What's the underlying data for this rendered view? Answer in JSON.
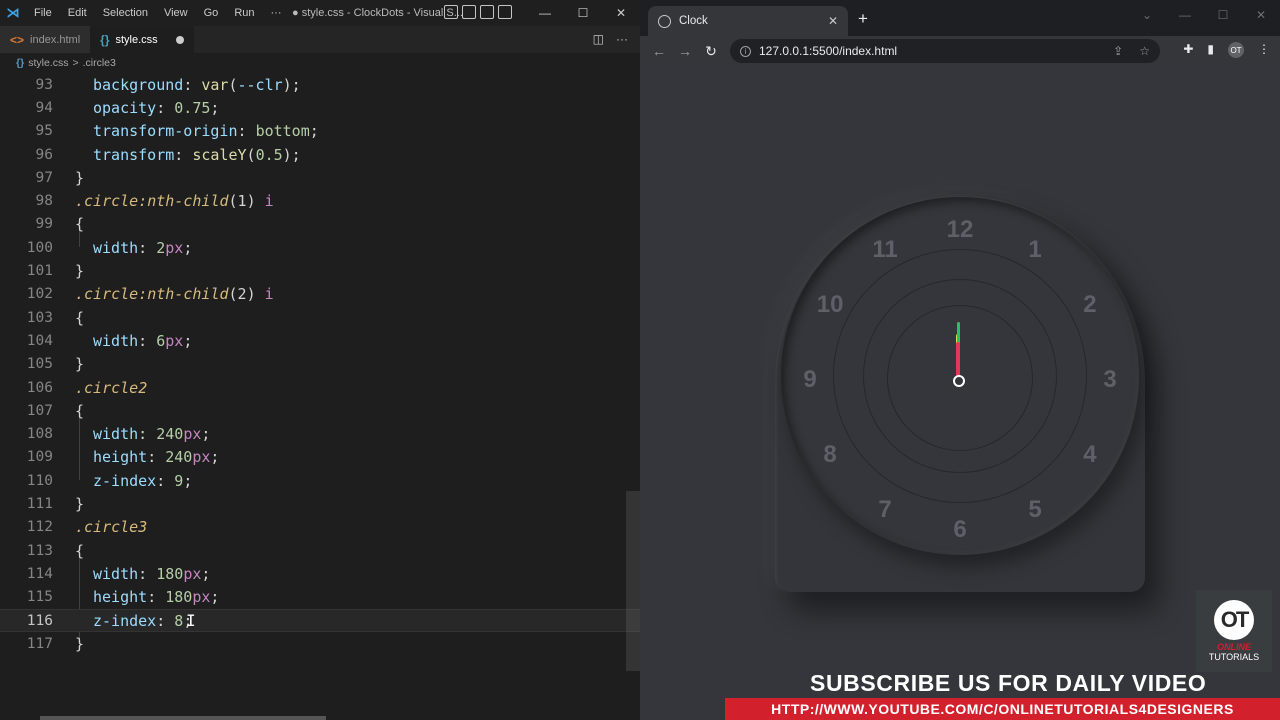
{
  "vscode": {
    "menu": [
      "File",
      "Edit",
      "Selection",
      "View",
      "Go",
      "Run",
      "···"
    ],
    "title": "● style.css - ClockDots - Visual S...",
    "tabs": [
      {
        "label": "index.html",
        "active": false
      },
      {
        "label": "style.css",
        "active": true,
        "dirty": true
      }
    ],
    "breadcrumb": {
      "file": "style.css",
      "sep": ">",
      "symbol": ".circle3"
    },
    "line_numbers": [
      "93",
      "94",
      "95",
      "96",
      "97",
      "98",
      "99",
      "100",
      "101",
      "102",
      "103",
      "104",
      "105",
      "106",
      "107",
      "108",
      "109",
      "110",
      "111",
      "112",
      "113",
      "114",
      "115",
      "116",
      "117"
    ],
    "current_line": "116",
    "code": {
      "l93": {
        "prop": "background",
        "fn": "var",
        "arg": "--clr"
      },
      "l94": {
        "prop": "opacity",
        "val": "0.75"
      },
      "l95": {
        "prop": "transform-origin",
        "val": "bottom"
      },
      "l96": {
        "prop": "transform",
        "fn": "scaleY",
        "arg": "0.5"
      },
      "l98": {
        "sel": ".circle",
        "pseudo": ":nth-child",
        "arg": "(1)",
        "child": "i"
      },
      "l100": {
        "prop": "width",
        "num": "2",
        "unit": "px"
      },
      "l102": {
        "sel": ".circle",
        "pseudo": ":nth-child",
        "arg": "(2)",
        "child": "i"
      },
      "l104": {
        "prop": "width",
        "num": "6",
        "unit": "px"
      },
      "l106": {
        "sel": ".circle2"
      },
      "l108": {
        "prop": "width",
        "num": "240",
        "unit": "px"
      },
      "l109": {
        "prop": "height",
        "num": "240",
        "unit": "px"
      },
      "l110": {
        "prop": "z-index",
        "num": "9"
      },
      "l112": {
        "sel": ".circle3"
      },
      "l114": {
        "prop": "width",
        "num": "180",
        "unit": "px"
      },
      "l115": {
        "prop": "height",
        "num": "180",
        "unit": "px"
      },
      "l116": {
        "prop": "z-index",
        "num": "8"
      }
    }
  },
  "browser": {
    "tab_title": "Clock",
    "url": "127.0.0.1:5500/index.html",
    "profile": "OT",
    "clock": {
      "numbers": [
        "12",
        "1",
        "2",
        "3",
        "4",
        "5",
        "6",
        "7",
        "8",
        "9",
        "10",
        "11"
      ],
      "hour_color": "#d4d94a",
      "minute_color": "#2ac06a",
      "second_color": "#e0385a"
    },
    "watermark": {
      "logo": "OT",
      "line1": "ONLINE",
      "line2": "TUTORIALS"
    },
    "subscribe_text": "SUBSCRIBE US FOR DAILY VIDEO",
    "channel_url": "HTTP://WWW.YOUTUBE.COM/C/ONLINETUTORIALS4DESIGNERS"
  }
}
